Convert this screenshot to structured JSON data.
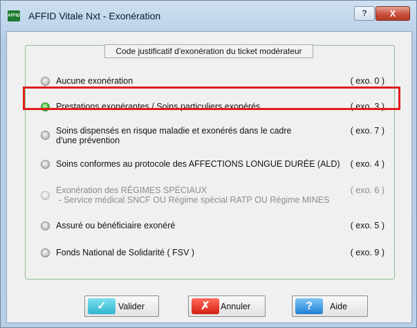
{
  "window": {
    "app_icon": "AFFID",
    "title": "AFFID Vitale Nxt - Exonération",
    "help_label": "?",
    "close_label": "X"
  },
  "group": {
    "title": "Code justificatif d'exonération du ticket modérateur"
  },
  "options": [
    {
      "label": "Aucune exonération",
      "code": "( exo. 0 )",
      "selected": false,
      "enabled": true
    },
    {
      "label": "Prestations exonérantes / Soins particuliers exonérés",
      "code": "( exo. 3 )",
      "selected": true,
      "enabled": true
    },
    {
      "label": "Soins dispensés en risque maladie et exonérés dans le cadre",
      "label2": "d'une prévention",
      "code": "( exo. 7 )",
      "selected": false,
      "enabled": true
    },
    {
      "label": "Soins conformes au protocole des AFFECTIONS LONGUE DURÉE (ALD)",
      "code": "( exo. 4 )",
      "selected": false,
      "enabled": true
    },
    {
      "label": "Exonération des RÉGIMES SPÉCIAUX",
      "label2": " - Service médical SNCF OU Régime spécial RATP OU Régime MINES",
      "code": "( exo. 6 )",
      "selected": false,
      "enabled": false
    },
    {
      "label": "Assuré ou bénéficiaire exonéré",
      "code": "( exo. 5 )",
      "selected": false,
      "enabled": true
    },
    {
      "label": "Fonds National de Solidarité ( FSV )",
      "code": "( exo. 9 )",
      "selected": false,
      "enabled": true
    }
  ],
  "buttons": {
    "validate_label": "Valider",
    "validate_icon": "✓",
    "cancel_label": "Annuler",
    "cancel_icon": "✗",
    "help_label": "Aide",
    "help_icon": "?"
  },
  "colors": {
    "highlight": "#e21c1c",
    "selected_radio": "#55c94b"
  }
}
